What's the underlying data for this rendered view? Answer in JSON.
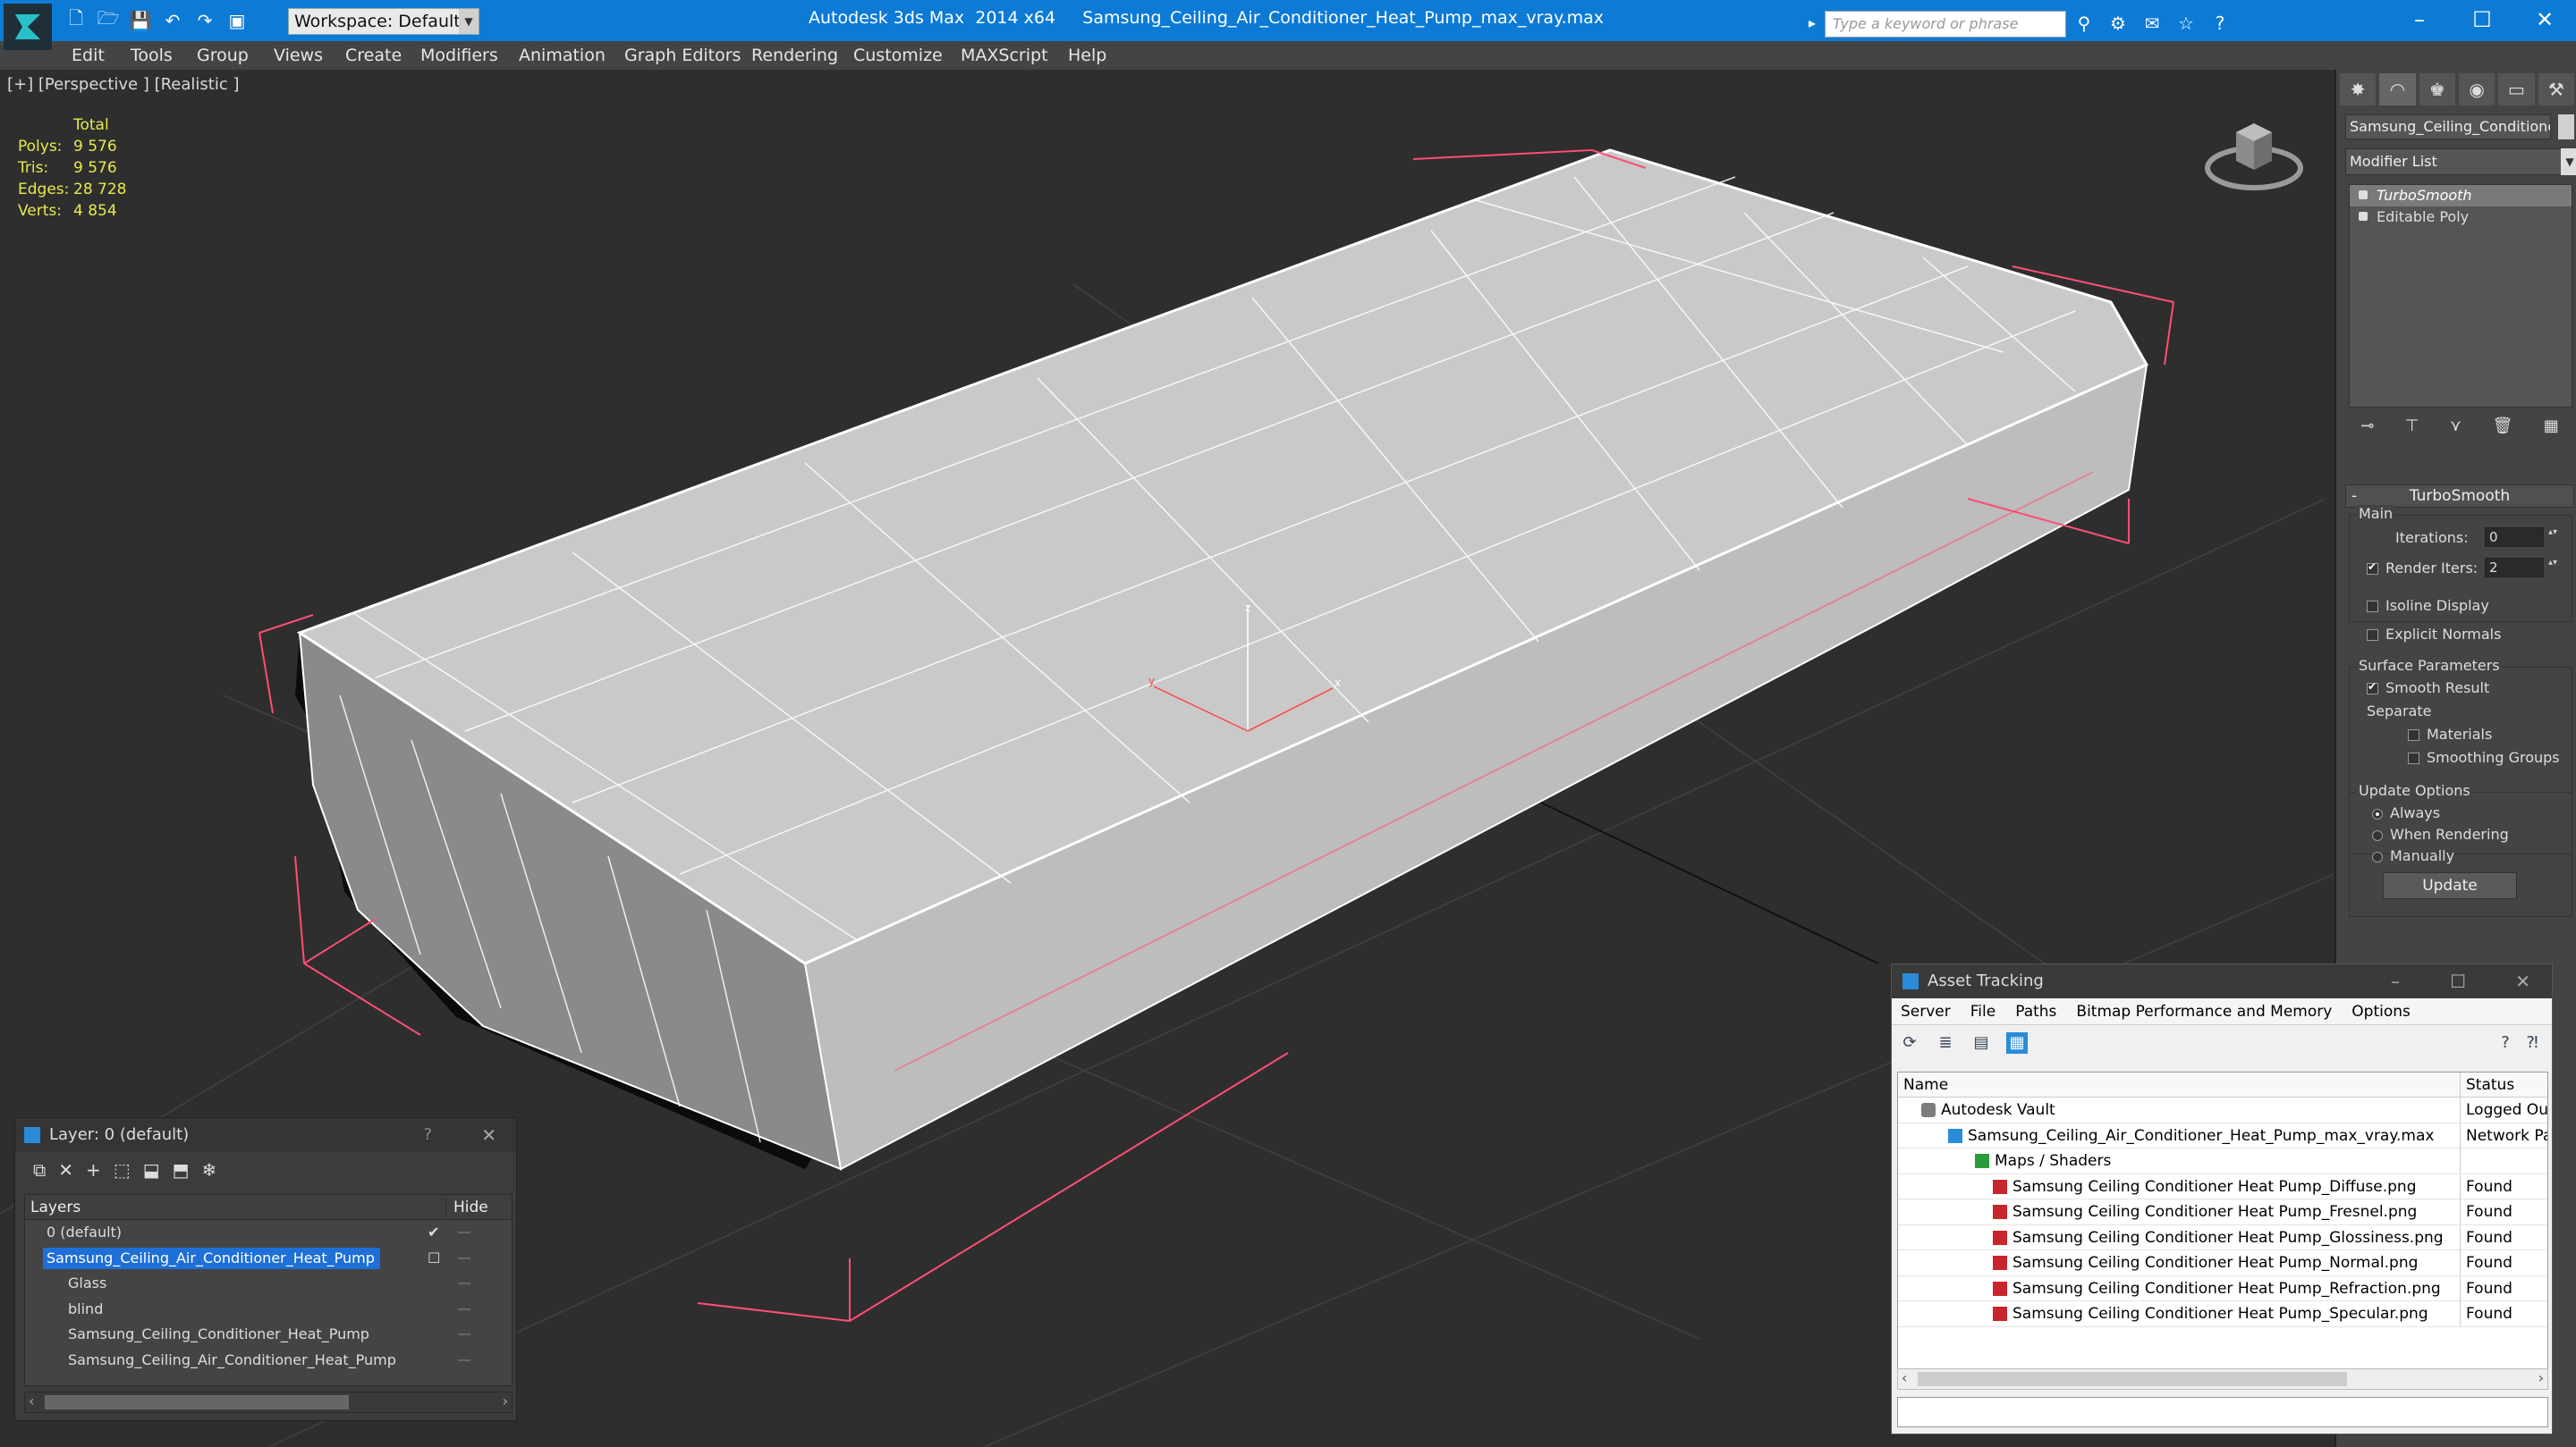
{
  "titlebar": {
    "workspace": "Workspace: Default",
    "app_title": "Autodesk 3ds Max  2014 x64     Samsung_Ceiling_Air_Conditioner_Heat_Pump_max_vray.max",
    "search_placeholder": "Type a keyword or phrase"
  },
  "menu": [
    "Edit",
    "Tools",
    "Group",
    "Views",
    "Create",
    "Modifiers",
    "Animation",
    "Graph Editors",
    "Rendering",
    "Customize",
    "MAXScript",
    "Help"
  ],
  "viewport": {
    "label": "[+] [Perspective ] [Realistic ]",
    "stats": {
      "total_label": "Total",
      "rows": [
        {
          "k": "Polys:",
          "v": "9 576"
        },
        {
          "k": "Tris:",
          "v": "9 576"
        },
        {
          "k": "Edges:",
          "v": "28 728"
        },
        {
          "k": "Verts:",
          "v": "4 854"
        }
      ]
    },
    "axes": {
      "x": "x",
      "y": "y",
      "z": "z"
    }
  },
  "command_panel": {
    "object_name": "Samsung_Ceiling_Conditioner",
    "modifier_list": "Modifier List",
    "stack": [
      "TurboSmooth",
      "Editable Poly"
    ],
    "rollout_title": "TurboSmooth",
    "main_label": "Main",
    "iterations_label": "Iterations:",
    "iterations_value": "0",
    "render_iters_label": "Render Iters:",
    "render_iters_value": "2",
    "isoline_display": "Isoline Display",
    "explicit_normals": "Explicit Normals",
    "surface_params_label": "Surface Parameters",
    "smooth_result": "Smooth Result",
    "separate_label": "Separate",
    "materials": "Materials",
    "smoothing_groups": "Smoothing Groups",
    "update_options_label": "Update Options",
    "always": "Always",
    "when_rendering": "When Rendering",
    "manually": "Manually",
    "update_button": "Update"
  },
  "layer_panel": {
    "title": "Layer: 0 (default)",
    "help": "?",
    "col_layers": "Layers",
    "col_hide": "Hide",
    "rows": [
      {
        "name": "0 (default)",
        "indent": 20
      },
      {
        "name": "Samsung_Ceiling_Air_Conditioner_Heat_Pump",
        "indent": 20
      },
      {
        "name": "Glass",
        "indent": 44
      },
      {
        "name": "blind",
        "indent": 44
      },
      {
        "name": "Samsung_Ceiling_Conditioner_Heat_Pump",
        "indent": 44
      },
      {
        "name": "Samsung_Ceiling_Air_Conditioner_Heat_Pump",
        "indent": 44
      }
    ]
  },
  "asset_tracking": {
    "title": "Asset Tracking",
    "menu": [
      "Server",
      "File",
      "Paths",
      "Bitmap Performance and Memory",
      "Options"
    ],
    "col_name": "Name",
    "col_status": "Status",
    "rows": [
      {
        "name": "Autodesk Vault",
        "status": "Logged Out",
        "icon": "vault"
      },
      {
        "name": "Samsung_Ceiling_Air_Conditioner_Heat_Pump_max_vray.max",
        "status": "Network Path",
        "icon": "max"
      },
      {
        "name": "Maps / Shaders",
        "status": "",
        "icon": "maps"
      },
      {
        "name": "Samsung Ceiling Conditioner Heat Pump_Diffuse.png",
        "status": "Found",
        "icon": "png"
      },
      {
        "name": "Samsung Ceiling Conditioner Heat Pump_Fresnel.png",
        "status": "Found",
        "icon": "png"
      },
      {
        "name": "Samsung Ceiling Conditioner Heat Pump_Glossiness.png",
        "status": "Found",
        "icon": "png"
      },
      {
        "name": "Samsung Ceiling Conditioner Heat Pump_Normal.png",
        "status": "Found",
        "icon": "png"
      },
      {
        "name": "Samsung Ceiling Conditioner Heat Pump_Refraction.png",
        "status": "Found",
        "icon": "png"
      },
      {
        "name": "Samsung Ceiling Conditioner Heat Pump_Specular.png",
        "status": "Found",
        "icon": "png"
      }
    ]
  },
  "colors": {
    "titlebar": "#0d7ad6",
    "selection": "#1e6fd6",
    "stats_text": "#e8e850"
  }
}
